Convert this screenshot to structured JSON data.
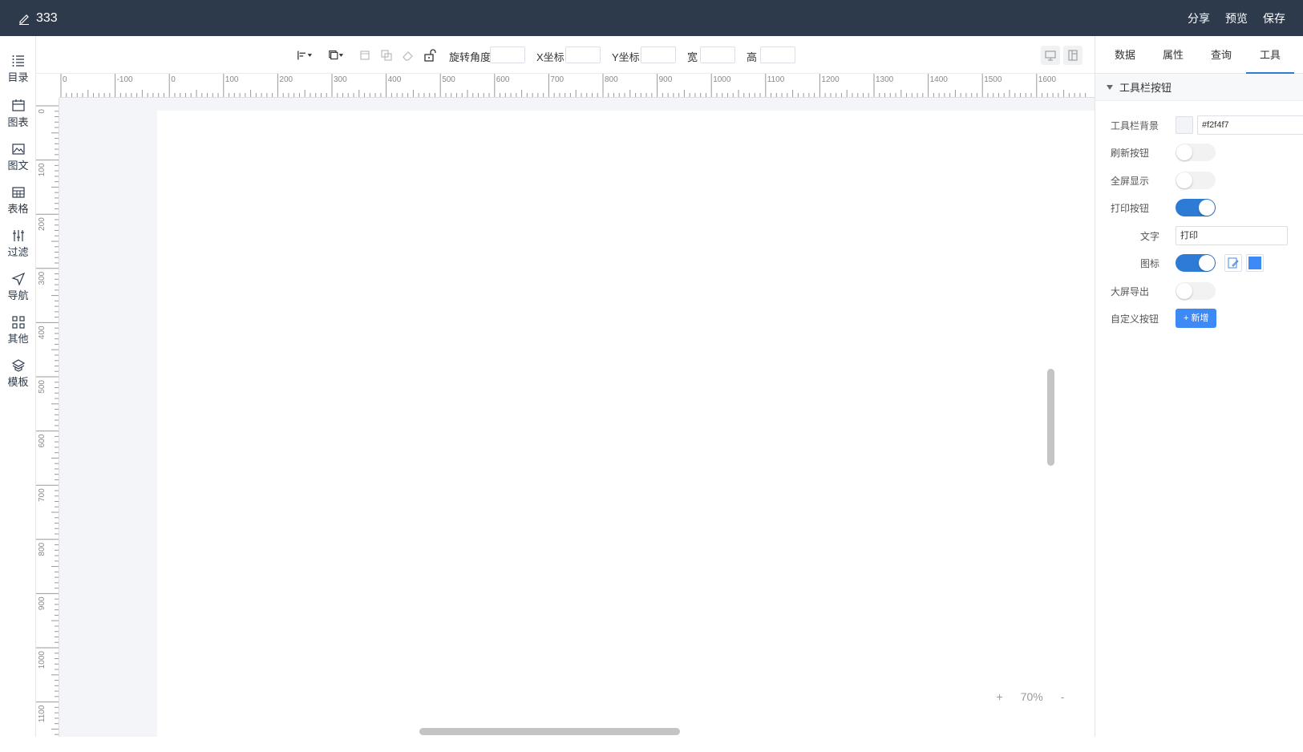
{
  "header": {
    "title": "333",
    "actions": [
      "分享",
      "预览",
      "保存"
    ]
  },
  "sidebar": {
    "items": [
      {
        "label": "目录",
        "icon": "list-icon"
      },
      {
        "label": "图表",
        "icon": "chart-calendar-icon"
      },
      {
        "label": "图文",
        "icon": "image-icon"
      },
      {
        "label": "表格",
        "icon": "table-icon"
      },
      {
        "label": "过滤",
        "icon": "filter-icon"
      },
      {
        "label": "导航",
        "icon": "navigation-icon"
      },
      {
        "label": "其他",
        "icon": "grid-icon"
      },
      {
        "label": "模板",
        "icon": "template-icon"
      }
    ]
  },
  "toolbar": {
    "rotate_label": "旋转角度",
    "x_label": "X坐标",
    "y_label": "Y坐标",
    "width_label": "宽",
    "height_label": "高",
    "rotate_value": "",
    "x_value": "",
    "y_value": "",
    "width_value": "",
    "height_value": ""
  },
  "ruler": {
    "h_ticks": [
      "0",
      "-100",
      "0",
      "100",
      "200",
      "300",
      "400",
      "500",
      "600",
      "700",
      "800",
      "900",
      "1000",
      "1100",
      "1200",
      "1300",
      "1400",
      "1500",
      "1600"
    ],
    "v_ticks": [
      "0",
      "100",
      "200",
      "300",
      "400",
      "500",
      "600",
      "700",
      "800",
      "900",
      "1000",
      "1100"
    ]
  },
  "zoom": {
    "plus": "+",
    "value": "70%",
    "minus": "-"
  },
  "panel": {
    "tabs": [
      "数据",
      "属性",
      "查询",
      "工具"
    ],
    "active_tab": "工具",
    "section_title": "工具栏按钮",
    "toolbar_bg_label": "工具栏背景",
    "toolbar_bg_value": "#f2f4f7",
    "refresh_label": "刷新按钮",
    "refresh_on": false,
    "fullscreen_label": "全屏显示",
    "fullscreen_on": false,
    "print_label": "打印按钮",
    "print_on": true,
    "text_label": "文字",
    "text_value": "打印",
    "icon_label": "图标",
    "icon_on": true,
    "icon_color": "#3d8af7",
    "bigscreen_label": "大屏导出",
    "bigscreen_on": false,
    "custom_label": "自定义按钮",
    "add_button": "+ 新增"
  },
  "colors": {
    "header_bg": "#2d3a4b",
    "accent": "#2e7bd6",
    "add_button_bg": "#3d8af7"
  }
}
